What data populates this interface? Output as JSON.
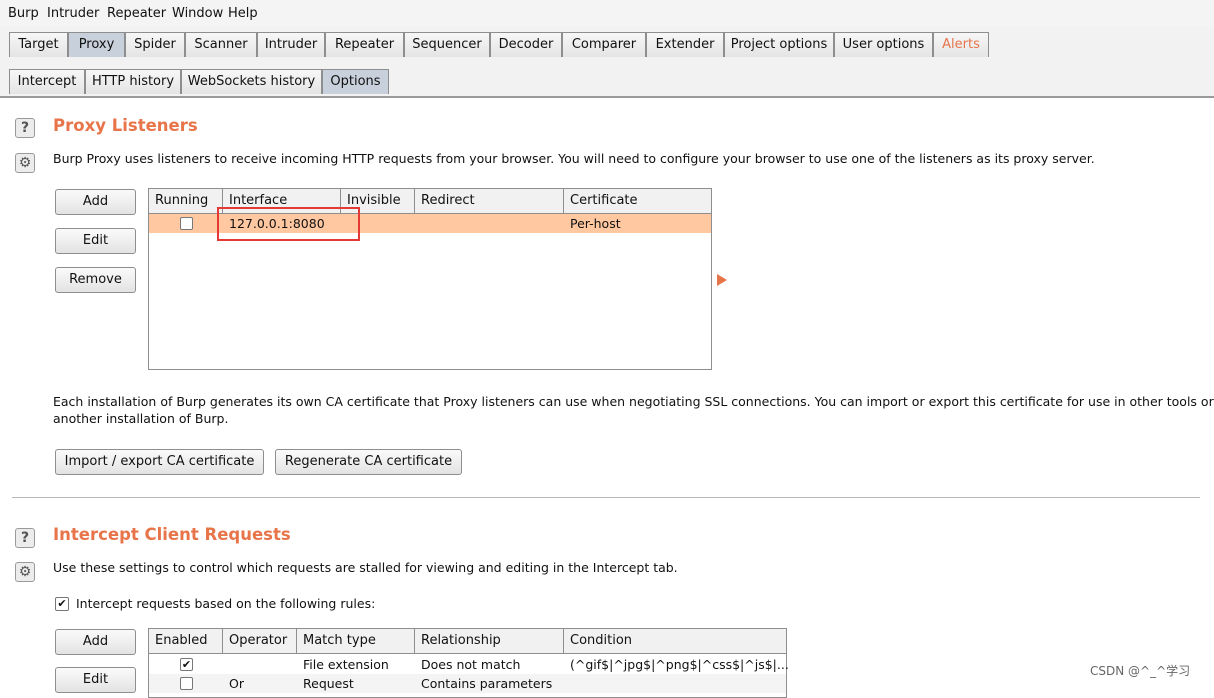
{
  "menu": [
    "Burp",
    "Intruder",
    "Repeater",
    "Window",
    "Help"
  ],
  "main_tabs": [
    "Target",
    "Proxy",
    "Spider",
    "Scanner",
    "Intruder",
    "Repeater",
    "Sequencer",
    "Decoder",
    "Comparer",
    "Extender",
    "Project options",
    "User options",
    "Alerts"
  ],
  "proxy_tabs": [
    "Intercept",
    "HTTP history",
    "WebSockets history",
    "Options"
  ],
  "listeners": {
    "title": "Proxy Listeners",
    "description": "Burp Proxy uses listeners to receive incoming HTTP requests from your browser. You will need to configure your browser to use one of the listeners as its proxy server.",
    "buttons": {
      "add": "Add",
      "edit": "Edit",
      "remove": "Remove"
    },
    "columns": [
      "Running",
      "Interface",
      "Invisible",
      "Redirect",
      "Certificate"
    ],
    "rows": [
      {
        "running": false,
        "interface": "127.0.0.1:8080",
        "invisible": "",
        "redirect": "",
        "certificate": "Per-host"
      }
    ]
  },
  "ca": {
    "text_line1": "Each installation of Burp generates its own CA certificate that Proxy listeners can use when negotiating SSL connections. You can import or export this certificate for use in other tools or",
    "text_line2": "another installation of Burp.",
    "import_button": "Import / export CA certificate",
    "regenerate_button": "Regenerate CA certificate"
  },
  "intercept": {
    "title": "Intercept Client Requests",
    "description": "Use these settings to control which requests are stalled for viewing and editing in the Intercept tab.",
    "checkbox_label": "Intercept requests based on the following rules:",
    "checkbox_checked": true,
    "buttons": {
      "add": "Add",
      "edit": "Edit"
    },
    "columns": [
      "Enabled",
      "Operator",
      "Match type",
      "Relationship",
      "Condition"
    ],
    "rows": [
      {
        "enabled": true,
        "operator": "",
        "match_type": "File extension",
        "relationship": "Does not match",
        "condition": "(^gif$|^jpg$|^png$|^css$|^js$|..."
      },
      {
        "enabled": false,
        "operator": "Or",
        "match_type": "Request",
        "relationship": "Contains parameters",
        "condition": ""
      }
    ]
  },
  "watermark": "CSDN @^_^学习",
  "colors": {
    "accent": "#e8744a",
    "selected_row": "#ffc8a0",
    "highlight_box": "#e53935"
  }
}
